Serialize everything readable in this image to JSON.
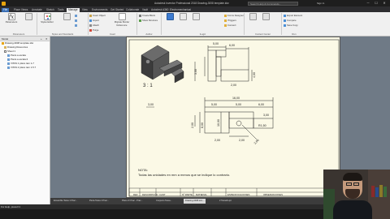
{
  "titlebar": {
    "title": "Autodesk Inventor Professional 2018   Drawing-3008 template.idw",
    "search_placeholder": "Search Help & Commands...",
    "user": "Sign In",
    "minimize": "─",
    "maximize": "☐",
    "close": "✕"
  },
  "ribbon_tabs": [
    "File",
    "Place Views",
    "Annotate",
    "Sketch",
    "Tools",
    "Manage",
    "View",
    "Environments",
    "Get Started",
    "Collaborate",
    "Vault",
    "Autodesk A360",
    "Electromechanical"
  ],
  "ribbon": {
    "buttons": {
      "parameters": "Parameters",
      "ilogic": "Add Rule",
      "styles_editor": "Styles Editor",
      "update_mass": "Update Mass",
      "insert_object": "Insert Object",
      "import": "Import",
      "attach": "Attach",
      "purge": "Purge",
      "migrate_border": "Migrate Border Reference",
      "create_block": "Create Block",
      "show_structure": "Show Structure",
      "add_rule": "Add Rule",
      "event_triggers": "Event Triggers",
      "ilogic_browser": "iLogic Browser",
      "forms": "Forms Designer",
      "triggers": "iTriggers",
      "connect": "Connect",
      "select_sheet": "Select Sheet",
      "export_element": "Export Element",
      "compare": "Compare",
      "save_copy": "Save Copy",
      "update": "Update",
      "clear": "Clear",
      "subst": "Subst"
    },
    "groups": [
      "Parameters",
      "Styles and Standards",
      "Insert",
      "Author",
      "iLogic",
      "Content Center",
      "Run"
    ]
  },
  "browser": {
    "header": "Model",
    "plus": "+",
    "close": "✕",
    "items": [
      "Drawing-3008 template.idw",
      "Drawing Resources",
      "Sheet:1",
      "Pieza a escala",
      "Pieza a escala:2",
      "VISTA 1 plano tam 1-7",
      "VISTA 2 plano tam 1.5.7"
    ]
  },
  "drawing": {
    "scale_label": "3 : 1",
    "dims": {
      "top_a": "5,00",
      "top_b": "6,00",
      "top_h": "7,00",
      "top_left": "3,00",
      "top_right": "4,00",
      "top_base": "2,00",
      "sec_label": "3,00",
      "front_total": "16,00",
      "front_a": "5,00",
      "front_b": "5,00",
      "front_c": "6,00",
      "front_d": "3,00",
      "front_height": "2,00",
      "front_left": "8,00",
      "front_left2": "2,00",
      "front_mid": "10,00",
      "front_hole": "R1,50",
      "front_bot_a": "2,00",
      "front_bot_b": "2,00",
      "front_bot_c": "2,00"
    },
    "note_title": "NOTA:",
    "note_text": "Todas las unidades en mm a menos que se indique lo contrario.",
    "title_block": [
      "REF",
      "DESCRIPCIÓN",
      "CANT",
      "Nº PARTE",
      "MATERIAL",
      "ESPECIFICACIONES",
      "OBSERVACIONES"
    ]
  },
  "doc_tabs": [
    "Ensamble Tarea 1 Prac...",
    "Pieza Tarea 1 Prac...",
    "Plano 2ª Prac - Prac...",
    "Conjunto Tarea...",
    "Drawing-3008 tem...",
    "2 Tamaño.ipt"
  ],
  "status": {
    "text": "For Help, press F1"
  },
  "colors": {
    "accent": "#e8a40c",
    "sheet": "#fbf9e6",
    "canvas": "#6f7a86"
  }
}
